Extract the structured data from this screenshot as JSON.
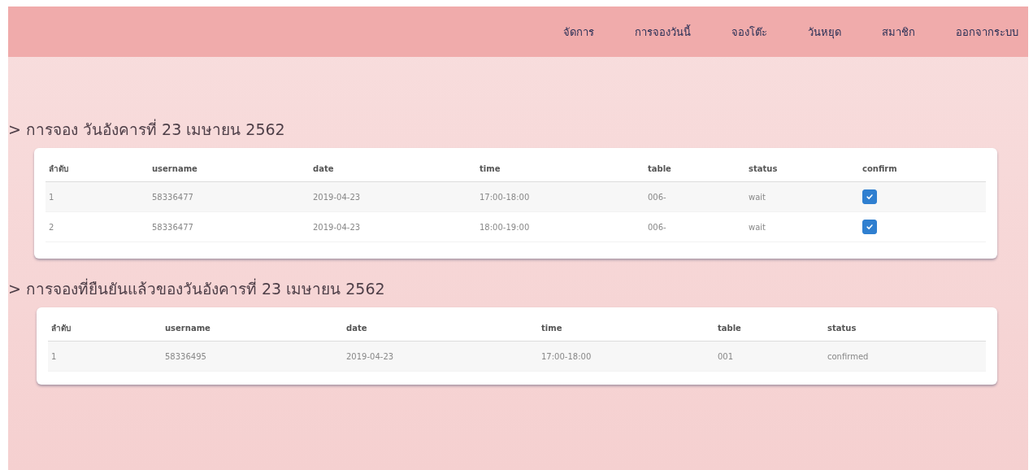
{
  "nav": {
    "items": [
      {
        "label": "จัดการ"
      },
      {
        "label": "การจองวันนี้"
      },
      {
        "label": "จองโต๊ะ"
      },
      {
        "label": "วันหยุด"
      },
      {
        "label": "สมาชิก"
      },
      {
        "label": "ออกจากระบบ"
      }
    ]
  },
  "sections": [
    {
      "heading": "> การจอง วันอังคารที่ 23 เมษายน 2562",
      "columns": [
        "ลำดับ",
        "username",
        "date",
        "time",
        "table",
        "status",
        "confirm"
      ],
      "rows": [
        {
          "cells": [
            "1",
            "58336477",
            "2019-04-23",
            "17:00-18:00",
            "006-",
            "wait"
          ],
          "checked": true
        },
        {
          "cells": [
            "2",
            "58336477",
            "2019-04-23",
            "18:00-19:00",
            "006-",
            "wait"
          ],
          "checked": true
        }
      ]
    },
    {
      "heading": "> การจองที่ยืนยันแล้วของวันอังคารที่ 23 เมษายน 2562",
      "columns": [
        "ลำดับ",
        "username",
        "date",
        "time",
        "table",
        "status"
      ],
      "rows": [
        {
          "cells": [
            "1",
            "58336495",
            "2019-04-23",
            "17:00-18:00",
            "001",
            "confirmed"
          ]
        }
      ]
    }
  ]
}
